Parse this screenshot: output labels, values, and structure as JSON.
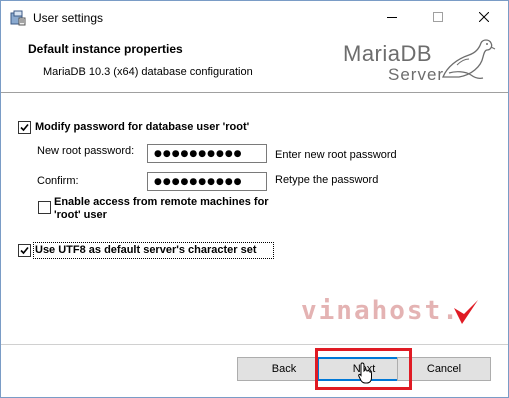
{
  "window": {
    "title": "User settings",
    "icon": "installer-icon"
  },
  "header": {
    "title": "Default instance properties",
    "subtitle": "MariaDB 10.3 (x64) database configuration",
    "logo_main": "MariaDB",
    "logo_sub": "Server"
  },
  "form": {
    "modify_password": {
      "label": "Modify password for database user 'root'",
      "checked": true
    },
    "new_password": {
      "label": "New root password:",
      "value": "●●●●●●●●●●",
      "hint": "Enter new root password"
    },
    "confirm": {
      "label": "Confirm:",
      "value": "●●●●●●●●●●",
      "hint": "Retype the password"
    },
    "remote_access": {
      "label_line1": "Enable access from remote machines for",
      "label_line2": "'root' user",
      "checked": false
    },
    "utf8": {
      "label": "Use UTF8 as default server's character set",
      "checked": true
    }
  },
  "watermark": {
    "text": "vinahost."
  },
  "footer": {
    "back_label": "Back",
    "next_label": "Next",
    "cancel_label": "Cancel"
  },
  "colors": {
    "highlight": "#e01b24",
    "focus": "#0078d7",
    "watermark": "#e4b3b3"
  }
}
